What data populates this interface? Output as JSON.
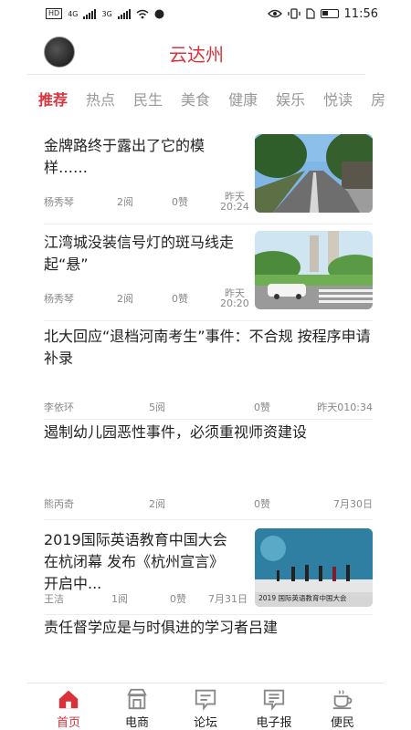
{
  "status_bar": {
    "hd": "HD",
    "net1": "4G",
    "net2": "3G",
    "time": "11:56"
  },
  "header": {
    "title": "云达州"
  },
  "tabs": [
    "推荐",
    "热点",
    "民生",
    "美食",
    "健康",
    "娱乐",
    "悦读",
    "房"
  ],
  "articles": [
    {
      "title": "金牌路终于露出了它的模样……",
      "author": "杨秀琴",
      "reads": "2阅",
      "likes": "0赞",
      "time_line1": "昨天",
      "time_line2": "20:24"
    },
    {
      "title": "江湾城没装信号灯的斑马线走起“悬”",
      "author": "杨秀琴",
      "reads": "2阅",
      "likes": "0赞",
      "time_line1": "昨天",
      "time_line2": "20:20"
    },
    {
      "title": "北大回应“退档河南考生”事件：不合规 按程序申请补录",
      "author": "李依环",
      "reads": "5阅",
      "likes": "0赞",
      "time": "昨天010:34"
    },
    {
      "title": "遏制幼儿园恶性事件，必须重视师资建设",
      "author": "熊丙奇",
      "reads": "2阅",
      "likes": "0赞",
      "time": "7月30日"
    },
    {
      "title": "2019国际英语教育中国大会在杭闭幕 发布《杭州宣言》 开启中...",
      "author": "王洁",
      "reads": "1阅",
      "likes": "0赞",
      "time": "7月31日",
      "image_text": "2019 国际英语教育中国大会"
    },
    {
      "title": "责任督学应是与时俱进的学习者吕建"
    }
  ],
  "bottom_nav": [
    {
      "label": "首页",
      "icon": "home-icon"
    },
    {
      "label": "电商",
      "icon": "shop-icon"
    },
    {
      "label": "论坛",
      "icon": "forum-icon"
    },
    {
      "label": "电子报",
      "icon": "newspaper-icon"
    },
    {
      "label": "便民",
      "icon": "coffee-icon"
    }
  ],
  "colors": {
    "accent": "#d9323a",
    "muted": "#888888"
  }
}
